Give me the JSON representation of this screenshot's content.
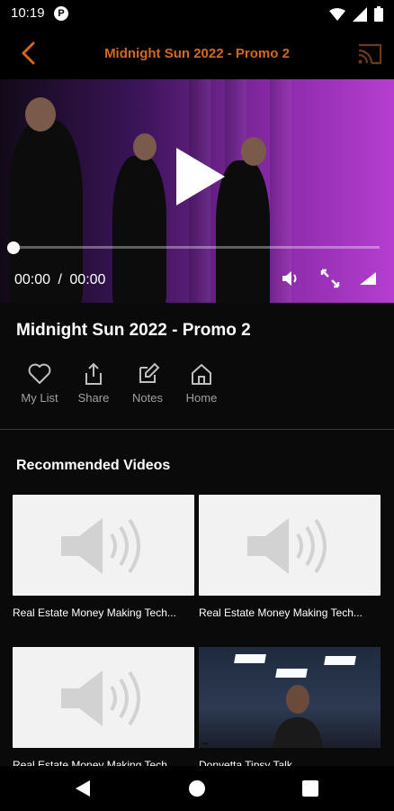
{
  "status_bar": {
    "time": "10:19",
    "app_icon_letter": "P"
  },
  "app_bar": {
    "title": "Midnight Sun 2022 - Promo 2",
    "accent": "#d2691e"
  },
  "player": {
    "current_time": "00:00",
    "separator": "/",
    "duration": "00:00",
    "progress": 0
  },
  "video": {
    "title": "Midnight Sun 2022 - Promo 2"
  },
  "actions": [
    {
      "label": "My List",
      "icon": "heart-icon"
    },
    {
      "label": "Share",
      "icon": "share-icon"
    },
    {
      "label": "Notes",
      "icon": "edit-icon"
    },
    {
      "label": "Home",
      "icon": "home-icon"
    }
  ],
  "recommended": {
    "heading": "Recommended Videos",
    "items": [
      {
        "title": "Real Estate Money Making Tech...",
        "thumbnail": "audio-placeholder"
      },
      {
        "title": "Real Estate Money Making Tech...",
        "thumbnail": "audio-placeholder"
      },
      {
        "title": "Real Estate Money Making Tech...",
        "thumbnail": "audio-placeholder"
      },
      {
        "title": "Donyetta Tipsy Talk",
        "thumbnail": "meeting-room"
      }
    ]
  }
}
